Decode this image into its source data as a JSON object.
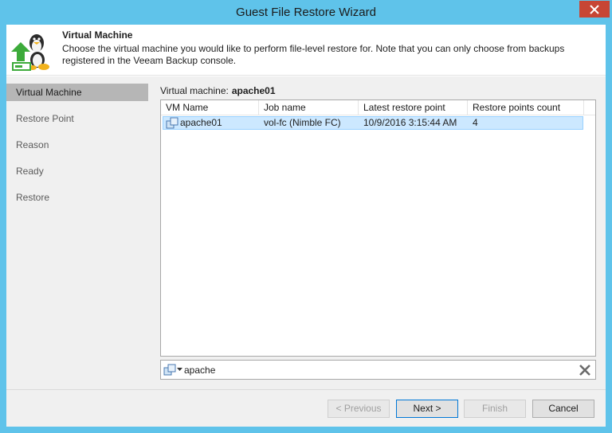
{
  "window": {
    "title": "Guest File Restore Wizard"
  },
  "header": {
    "title": "Virtual Machine",
    "description": "Choose the virtual machine you would like to perform file-level restore for. Note that you can only choose from backups registered in the Veeam Backup console."
  },
  "sidebar": {
    "items": [
      {
        "label": "Virtual Machine",
        "active": true
      },
      {
        "label": "Restore Point",
        "active": false
      },
      {
        "label": "Reason",
        "active": false
      },
      {
        "label": "Ready",
        "active": false
      },
      {
        "label": "Restore",
        "active": false
      }
    ]
  },
  "main": {
    "vm_label": "Virtual machine:",
    "vm_value": "apache01",
    "table": {
      "columns": [
        "VM Name",
        "Job name",
        "Latest restore point",
        "Restore points count"
      ],
      "rows": [
        {
          "vm_name": "apache01",
          "job_name": "vol-fc (Nimble FC)",
          "latest_restore_point": "10/9/2016 3:15:44 AM",
          "restore_points_count": "4",
          "selected": true
        }
      ]
    },
    "search": {
      "value": "apache",
      "icon": "vm-type-icon"
    }
  },
  "footer": {
    "previous": "< Previous",
    "next": "Next >",
    "finish": "Finish",
    "cancel": "Cancel"
  },
  "colors": {
    "title_bar": "#5fc3ea",
    "close_button": "#c74635",
    "selection": "#cce8ff",
    "nav_active": "#b6b6b6"
  }
}
